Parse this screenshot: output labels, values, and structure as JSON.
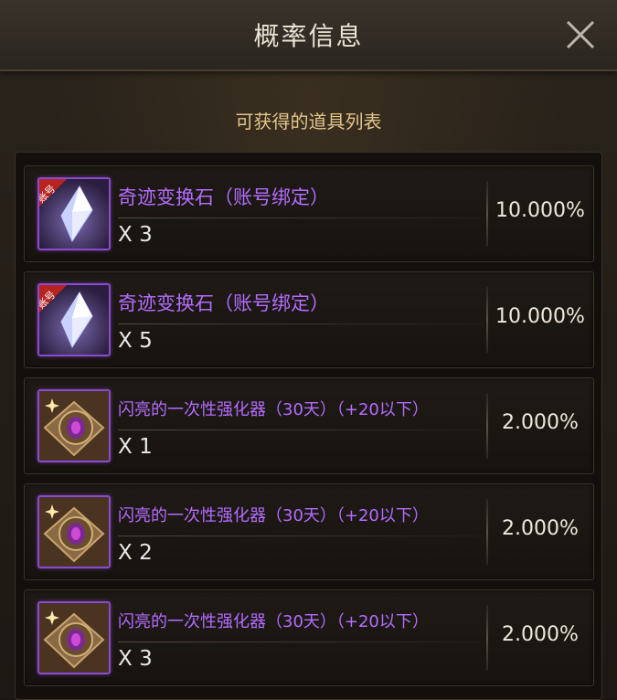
{
  "window": {
    "title": "概率信息",
    "close_icon": "close-icon"
  },
  "subtitle": "可获得的道具列表",
  "items": [
    {
      "name": "奇迹变换石（账号绑定）",
      "qty": "X 3",
      "probability": "10.000%",
      "icon": "crystal-icon",
      "badge": "账号"
    },
    {
      "name": "奇迹变换石（账号绑定）",
      "qty": "X 5",
      "probability": "10.000%",
      "icon": "crystal-icon",
      "badge": "账号"
    },
    {
      "name": "闪亮的一次性强化器（30天）（+20以下）",
      "qty": "X 1",
      "probability": "2.000%",
      "icon": "enhancer-icon"
    },
    {
      "name": "闪亮的一次性强化器（30天）（+20以下）",
      "qty": "X 2",
      "probability": "2.000%",
      "icon": "enhancer-icon"
    },
    {
      "name": "闪亮的一次性强化器（30天）（+20以下）",
      "qty": "X 3",
      "probability": "2.000%",
      "icon": "enhancer-icon"
    }
  ],
  "colors": {
    "item_name": "#b46cff",
    "icon_border": "#8a4bd0",
    "subtitle": "#e3c58b"
  }
}
